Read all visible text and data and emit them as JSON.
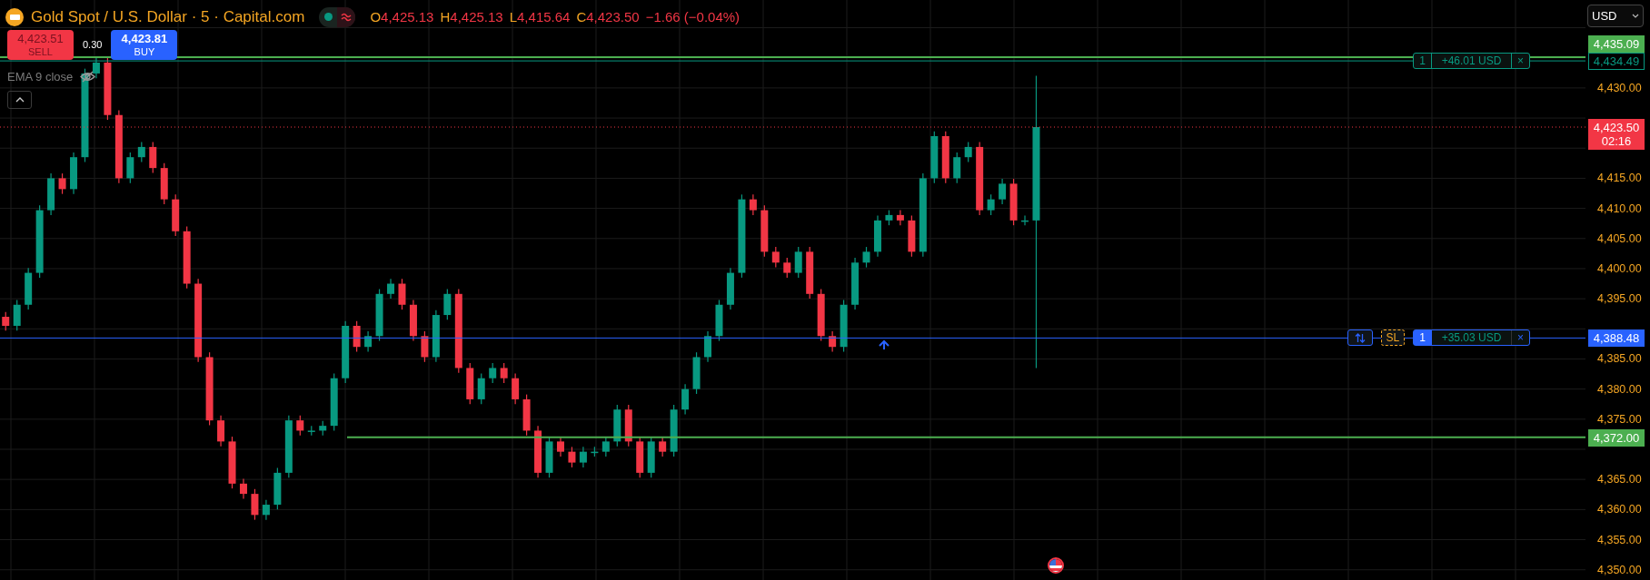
{
  "header": {
    "symbol": "Gold Spot / U.S. Dollar · 5 · Capital.com",
    "ohlc": [
      {
        "label": "O",
        "value": "4,425.13"
      },
      {
        "label": "H",
        "value": "4,425.13"
      },
      {
        "label": "L",
        "value": "4,415.64"
      },
      {
        "label": "C",
        "value": "4,423.50"
      }
    ],
    "change": "−1.66 (−0.04%)"
  },
  "trade": {
    "sell_price": "4,423.51",
    "sell_label": "SELL",
    "spread": "0.30",
    "buy_price": "4,423.81",
    "buy_label": "BUY"
  },
  "indicator": {
    "label": "EMA 9 close"
  },
  "currency": "USD",
  "chart": {
    "chart_data": {
      "type": "candlestick",
      "grid": true,
      "ylim": [
        4348.3,
        4444.6
      ],
      "categories": [
        null,
        null,
        null,
        null,
        null,
        null,
        null,
        null,
        null,
        null,
        null,
        null,
        null,
        null,
        null,
        null,
        null,
        null,
        null,
        null,
        null,
        null,
        null,
        null,
        null,
        null,
        null,
        null,
        null,
        null,
        null,
        null,
        null,
        null,
        null,
        null,
        null,
        null,
        null,
        null,
        null,
        null,
        null,
        null,
        null,
        null,
        null,
        null,
        null,
        null,
        null,
        null,
        null,
        null,
        null,
        null,
        null,
        null,
        null,
        null,
        null,
        null,
        null,
        null,
        null,
        null,
        null,
        null,
        null,
        null,
        null,
        null,
        null,
        null,
        null,
        null,
        null,
        null,
        null,
        null,
        null,
        null,
        null,
        null,
        null,
        null,
        null,
        null,
        null,
        null,
        null,
        null,
        null,
        null,
        null,
        null,
        null,
        null,
        null,
        null,
        null,
        null,
        null,
        null,
        null,
        null,
        null,
        null,
        null,
        null,
        null,
        null,
        null,
        null,
        null,
        null,
        null,
        null,
        null,
        null,
        null,
        null,
        null,
        null,
        null,
        null,
        null,
        null,
        null,
        null,
        null,
        null,
        null,
        null,
        null,
        null,
        null,
        null,
        null,
        null
      ],
      "yticks": [
        {
          "value": 4350,
          "label": "4,350.00"
        },
        {
          "value": 4355,
          "label": "4,355.00"
        },
        {
          "value": 4360,
          "label": "4,360.00"
        },
        {
          "value": 4365,
          "label": "4,365.00"
        },
        {
          "value": 4375,
          "label": "4,375.00"
        },
        {
          "value": 4380,
          "label": "4,380.00"
        },
        {
          "value": 4385,
          "label": "4,385.00"
        },
        {
          "value": 4395,
          "label": "4,395.00"
        },
        {
          "value": 4400,
          "label": "4,400.00"
        },
        {
          "value": 4405,
          "label": "4,405.00"
        },
        {
          "value": 4410,
          "label": "4,410.00"
        },
        {
          "value": 4415,
          "label": "4,415.00"
        },
        {
          "value": 4430,
          "label": "4,430.00"
        }
      ],
      "ohlc": [
        [
          4392.0,
          4392.8,
          4389.7,
          4390.5
        ],
        [
          4390.5,
          4394.8,
          4389.7,
          4394.0
        ],
        [
          4394.0,
          4400.1,
          4393.2,
          4399.3
        ],
        [
          4399.3,
          4410.5,
          4398.5,
          4409.7
        ],
        [
          4409.7,
          4415.8,
          4408.9,
          4415.0
        ],
        [
          4415.0,
          4415.8,
          4412.4,
          4413.2
        ],
        [
          4413.2,
          4419.3,
          4412.4,
          4418.5
        ],
        [
          4418.5,
          4433.2,
          4417.7,
          4432.4
        ],
        [
          4432.4,
          4435.0,
          4431.6,
          4434.2
        ],
        [
          4434.2,
          4435.0,
          4424.7,
          4425.5
        ],
        [
          4425.5,
          4426.3,
          4414.2,
          4415.0
        ],
        [
          4415.0,
          4419.3,
          4414.2,
          4418.5
        ],
        [
          4418.5,
          4421.0,
          4417.7,
          4420.2
        ],
        [
          4420.2,
          4421.0,
          4415.9,
          4416.7
        ],
        [
          4416.7,
          4417.5,
          4410.7,
          4411.5
        ],
        [
          4411.5,
          4412.3,
          4405.4,
          4406.2
        ],
        [
          4406.2,
          4407.0,
          4396.7,
          4397.5
        ],
        [
          4397.5,
          4398.3,
          4384.5,
          4385.3
        ],
        [
          4385.3,
          4386.1,
          4374.0,
          4374.8
        ],
        [
          4374.8,
          4375.6,
          4370.5,
          4371.3
        ],
        [
          4371.3,
          4372.1,
          4363.5,
          4364.3
        ],
        [
          4364.3,
          4365.1,
          4361.8,
          4362.6
        ],
        [
          4362.6,
          4363.4,
          4358.3,
          4359.1
        ],
        [
          4359.1,
          4361.6,
          4358.3,
          4360.8
        ],
        [
          4360.8,
          4366.9,
          4360.0,
          4366.1
        ],
        [
          4366.1,
          4375.6,
          4365.3,
          4374.8
        ],
        [
          4374.8,
          4375.6,
          4372.3,
          4373.1
        ],
        [
          4373.1,
          4373.9,
          4372.3,
          4373.1
        ],
        [
          4373.1,
          4374.7,
          4372.3,
          4373.9
        ],
        [
          4373.9,
          4382.6,
          4373.1,
          4381.8
        ],
        [
          4381.8,
          4391.3,
          4381.0,
          4390.5
        ],
        [
          4390.5,
          4391.3,
          4386.2,
          4387.0
        ],
        [
          4387.0,
          4389.6,
          4386.2,
          4388.8
        ],
        [
          4388.8,
          4396.6,
          4388.0,
          4395.8
        ],
        [
          4395.8,
          4398.3,
          4395.0,
          4397.5
        ],
        [
          4397.5,
          4398.3,
          4393.2,
          4394.0
        ],
        [
          4394.0,
          4394.8,
          4388.0,
          4388.8
        ],
        [
          4388.8,
          4389.6,
          4384.5,
          4385.3
        ],
        [
          4385.3,
          4393.1,
          4384.5,
          4392.3
        ],
        [
          4392.3,
          4396.6,
          4391.5,
          4395.8
        ],
        [
          4395.8,
          4396.6,
          4382.7,
          4383.5
        ],
        [
          4383.5,
          4384.3,
          4377.5,
          4378.3
        ],
        [
          4378.3,
          4382.6,
          4377.5,
          4381.8
        ],
        [
          4381.8,
          4384.3,
          4381.0,
          4383.5
        ],
        [
          4383.5,
          4384.3,
          4381.0,
          4381.8
        ],
        [
          4381.8,
          4382.6,
          4377.5,
          4378.3
        ],
        [
          4378.3,
          4379.1,
          4372.3,
          4373.1
        ],
        [
          4373.1,
          4373.9,
          4365.3,
          4366.1
        ],
        [
          4366.1,
          4372.1,
          4365.3,
          4371.3
        ],
        [
          4371.3,
          4372.1,
          4368.8,
          4369.6
        ],
        [
          4369.6,
          4370.4,
          4367.0,
          4367.8
        ],
        [
          4367.8,
          4370.4,
          4367.0,
          4369.6
        ],
        [
          4369.6,
          4370.4,
          4368.8,
          4369.6
        ],
        [
          4369.6,
          4372.1,
          4368.8,
          4371.3
        ],
        [
          4371.3,
          4377.4,
          4370.5,
          4376.6
        ],
        [
          4376.6,
          4377.4,
          4370.5,
          4371.3
        ],
        [
          4371.3,
          4372.1,
          4365.3,
          4366.1
        ],
        [
          4366.1,
          4372.1,
          4365.3,
          4371.3
        ],
        [
          4371.3,
          4372.1,
          4368.8,
          4369.6
        ],
        [
          4369.6,
          4377.4,
          4368.8,
          4376.6
        ],
        [
          4376.6,
          4380.8,
          4375.8,
          4380.0
        ],
        [
          4380.0,
          4386.1,
          4379.2,
          4385.3
        ],
        [
          4385.3,
          4389.6,
          4384.5,
          4388.8
        ],
        [
          4388.8,
          4394.8,
          4388.0,
          4394.0
        ],
        [
          4394.0,
          4400.1,
          4393.2,
          4399.3
        ],
        [
          4399.3,
          4412.3,
          4398.5,
          4411.5
        ],
        [
          4411.5,
          4412.3,
          4408.9,
          4409.7
        ],
        [
          4409.7,
          4410.5,
          4402.0,
          4402.8
        ],
        [
          4402.8,
          4403.6,
          4400.2,
          4401.0
        ],
        [
          4401.0,
          4401.8,
          4398.5,
          4399.3
        ],
        [
          4399.3,
          4403.6,
          4398.5,
          4402.8
        ],
        [
          4402.8,
          4403.6,
          4395.0,
          4395.8
        ],
        [
          4395.8,
          4396.6,
          4388.0,
          4388.8
        ],
        [
          4388.8,
          4389.6,
          4386.2,
          4387.0
        ],
        [
          4387.0,
          4394.8,
          4386.2,
          4394.0
        ],
        [
          4394.0,
          4401.8,
          4393.2,
          4401.0
        ],
        [
          4401.0,
          4403.6,
          4400.2,
          4402.8
        ],
        [
          4402.8,
          4408.8,
          4402.0,
          4408.0
        ],
        [
          4408.0,
          4409.7,
          4407.2,
          4408.9
        ],
        [
          4408.9,
          4409.7,
          4407.2,
          4408.0
        ],
        [
          4408.0,
          4408.8,
          4402.0,
          4402.8
        ],
        [
          4402.8,
          4415.8,
          4402.0,
          4415.0
        ],
        [
          4415.0,
          4422.8,
          4414.2,
          4422.0
        ],
        [
          4422.0,
          4422.8,
          4414.2,
          4415.0
        ],
        [
          4415.0,
          4419.3,
          4414.2,
          4418.5
        ],
        [
          4418.5,
          4421.0,
          4417.7,
          4420.2
        ],
        [
          4420.2,
          4421.0,
          4408.9,
          4409.7
        ],
        [
          4409.7,
          4412.3,
          4408.9,
          4411.5
        ],
        [
          4411.5,
          4414.9,
          4410.7,
          4414.1
        ],
        [
          4414.1,
          4414.9,
          4407.2,
          4408.0
        ],
        [
          4408.0,
          4408.8,
          4407.2,
          4408.0
        ],
        [
          4408.0,
          4432.0,
          4383.5,
          4423.5
        ],
        null,
        null,
        null,
        null,
        null,
        null,
        null,
        null,
        null,
        null,
        null,
        null,
        null,
        null,
        null,
        null,
        null,
        null,
        null,
        null,
        null,
        null,
        null,
        null,
        null,
        null,
        null,
        null,
        null,
        null,
        null,
        null,
        null,
        null,
        null,
        null,
        null,
        null,
        null,
        null,
        null,
        null,
        null,
        null,
        null,
        null,
        null,
        null
      ],
      "ref_lines": [
        {
          "axis": "y",
          "value": 4435.09,
          "color": "#4caf50"
        },
        {
          "axis": "y",
          "value": 4434.49,
          "color": "#089981"
        },
        {
          "axis": "y",
          "value": 4423.5,
          "color": "#f23645"
        },
        {
          "axis": "y",
          "value": 4388.48,
          "color": "#2962ff"
        },
        {
          "axis": "y",
          "value": 4372.0,
          "color": "#4caf50"
        }
      ]
    }
  },
  "price_lines": [
    {
      "kind": "target",
      "label": "4,435.09"
    },
    {
      "kind": "position",
      "label": "4,434.49",
      "order": {
        "quantity": "1",
        "pnl": "+46.01 USD",
        "close": "×"
      }
    },
    {
      "kind": "last_price",
      "label": "4,423.50",
      "countdown": "02:16"
    },
    {
      "kind": "active_position",
      "label": "4,388.48",
      "order": {
        "quantity": "1",
        "pnl": "+35.03 USD",
        "close": "×",
        "sl": "SL"
      }
    },
    {
      "kind": "level",
      "label": "4,372.00"
    }
  ]
}
